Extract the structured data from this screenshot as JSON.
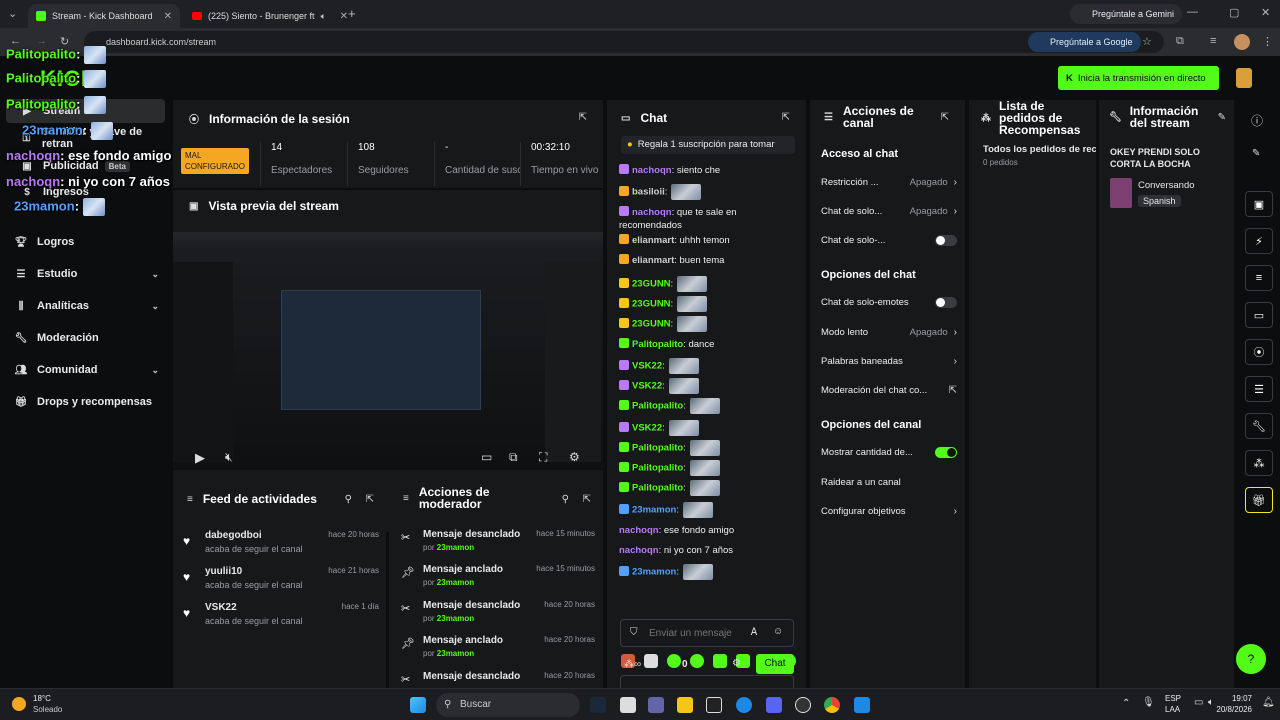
{
  "browser": {
    "tabs": [
      {
        "title": "Stream - Kick Dashboard",
        "active": true
      },
      {
        "title": "(225) Siento - Brunenger ft",
        "active": false
      }
    ],
    "url": "dashboard.kick.com/stream",
    "gemini_label": "Pregúntale a Gemini",
    "google_label": "Pregúntale a Google"
  },
  "header": {
    "start_stream_label": "Inicia la transmisión en directo"
  },
  "overlay_chat": [
    {
      "user": "Palitopalito",
      "text": ":",
      "color": "#53fc18"
    },
    {
      "user": "Palitopalito",
      "text": ":",
      "color": "#53fc18"
    },
    {
      "user": "Palitopalito",
      "text": ":",
      "color": "#53fc18"
    },
    {
      "user": "23mamon",
      "text": ":",
      "color": "#53a0fc"
    },
    {
      "user": "nachoqn",
      "text": ": ese fondo amigo",
      "color": "#b879f7"
    },
    {
      "user": "nachoqn",
      "text": ": ni yo con 7 años",
      "color": "#b879f7"
    },
    {
      "user": "23mamon",
      "text": ":",
      "color": "#53a0fc"
    }
  ],
  "sidebar": {
    "items": [
      {
        "label": "Stream",
        "icon": "stream-icon"
      },
      {
        "label": "Servidor y clave de retran",
        "icon": "key-icon"
      },
      {
        "label": "Publicidad",
        "badge": "Beta",
        "icon": "ad-icon"
      },
      {
        "label": "Ingresos",
        "icon": "money-icon"
      },
      {
        "label": "Logros",
        "icon": "trophy-icon"
      },
      {
        "label": "Estudio",
        "icon": "studio-icon",
        "expandable": true
      },
      {
        "label": "Analíticas",
        "icon": "chart-icon",
        "expandable": true
      },
      {
        "label": "Moderación",
        "icon": "wrench-icon"
      },
      {
        "label": "Comunidad",
        "icon": "users-icon",
        "expandable": true
      },
      {
        "label": "Drops y recompensas",
        "icon": "gift-icon"
      }
    ]
  },
  "session": {
    "title": "Información de la sesión",
    "status_label": "MAL CONFIGURADO",
    "stats": [
      {
        "value": "14",
        "label": "Espectadores"
      },
      {
        "value": "108",
        "label": "Seguidores"
      },
      {
        "value": "-",
        "label": "Cantidad de suscripciones"
      },
      {
        "value": "00:32:10",
        "label": "Tiempo en vivo"
      }
    ]
  },
  "preview": {
    "title": "Vista previa del stream"
  },
  "activity": {
    "title": "Feed de actividades",
    "items": [
      {
        "name": "dabegodboi",
        "sub": "acaba de seguir el canal",
        "time": "hace 20 horas"
      },
      {
        "name": "yuulii10",
        "sub": "acaba de seguir el canal",
        "time": "hace 21 horas"
      },
      {
        "name": "VSK22",
        "sub": "acaba de seguir el canal",
        "time": "hace 1 día"
      }
    ]
  },
  "mod_actions": {
    "title": "Acciones de moderador",
    "items": [
      {
        "name": "Mensaje desanclado",
        "by": "por",
        "user": "23mamon",
        "time": "hace 15 minutos"
      },
      {
        "name": "Mensaje anclado",
        "by": "por",
        "user": "23mamon",
        "time": "hace 15 minutos"
      },
      {
        "name": "Mensaje desanclado",
        "by": "por",
        "user": "23mamon",
        "time": "hace 20 horas"
      },
      {
        "name": "Mensaje anclado",
        "by": "por",
        "user": "23mamon",
        "time": "hace 20 horas"
      },
      {
        "name": "Mensaje desanclado",
        "by": "por",
        "user": "23mamon",
        "time": "hace 20 horas"
      }
    ]
  },
  "chat": {
    "title": "Chat",
    "pinned": "Regala 1 suscripción para tomar",
    "messages": [
      {
        "user": "nachoqn",
        "text": ": siento che",
        "color": "#b879f7"
      },
      {
        "user": "basiloii",
        "text": ":",
        "color": "#cfcfcf"
      },
      {
        "user": "nachoqn",
        "text": ": que te sale en recomendados",
        "color": "#b879f7"
      },
      {
        "user": "elianmart",
        "text": ": uhhh temon",
        "color": "#cfcfcf"
      },
      {
        "user": "elianmart",
        "text": ": buen tema",
        "color": "#cfcfcf"
      },
      {
        "user": "23GUNN",
        "text": ":",
        "color": "#53fc18"
      },
      {
        "user": "23GUNN",
        "text": ":",
        "color": "#53fc18"
      },
      {
        "user": "23GUNN",
        "text": ":",
        "color": "#53fc18"
      },
      {
        "user": "Palitopalito",
        "text": ": dance",
        "color": "#53fc18"
      },
      {
        "user": "VSK22",
        "text": ":",
        "color": "#53fc18"
      },
      {
        "user": "VSK22",
        "text": ":",
        "color": "#53fc18"
      },
      {
        "user": "Palitopalito",
        "text": ":",
        "color": "#53fc18"
      },
      {
        "user": "VSK22",
        "text": ":",
        "color": "#53fc18"
      },
      {
        "user": "Palitopalito",
        "text": ":",
        "color": "#53fc18"
      },
      {
        "user": "Palitopalito",
        "text": ":",
        "color": "#53fc18"
      },
      {
        "user": "Palitopalito",
        "text": ":",
        "color": "#53fc18"
      },
      {
        "user": "23mamon",
        "text": ":",
        "color": "#53a0fc"
      },
      {
        "user": "nachoqn",
        "text": ": ese fondo amigo",
        "color": "#b879f7"
      },
      {
        "user": "nachoqn",
        "text": ": ni yo con 7 años",
        "color": "#b879f7"
      },
      {
        "user": "23mamon",
        "text": ":",
        "color": "#53a0fc"
      }
    ],
    "input_placeholder": "Enviar un mensaje",
    "points": "0",
    "send_label": "Chat"
  },
  "channel_actions": {
    "title": "Acciones de canal",
    "sections": [
      {
        "heading": "Acceso al chat"
      },
      {
        "heading": "Opciones del chat"
      },
      {
        "heading": "Opciones del canal"
      }
    ],
    "rows": [
      {
        "label": "Restricción ...",
        "value": "Apagado",
        "kind": "arrow"
      },
      {
        "label": "Chat de solo...",
        "value": "Apagado",
        "kind": "arrow"
      },
      {
        "label": "Chat de solo-...",
        "value": "",
        "kind": "toggle-off"
      },
      {
        "label": "Chat de solo-emotes",
        "value": "",
        "kind": "toggle-off"
      },
      {
        "label": "Modo lento",
        "value": "Apagado",
        "kind": "arrow"
      },
      {
        "label": "Palabras baneadas",
        "value": "",
        "kind": "arrow"
      },
      {
        "label": "Moderación del chat co...",
        "value": "",
        "kind": "external"
      },
      {
        "label": "Mostrar cantidad de...",
        "value": "",
        "kind": "toggle-on"
      },
      {
        "label": "Raidear a un canal",
        "value": "",
        "kind": "none"
      },
      {
        "label": "Configurar objetivos",
        "value": "",
        "kind": "arrow"
      }
    ]
  },
  "rewards": {
    "title": "Lista de pedidos de Recompensas",
    "all_label": "Todos los pedidos de rec",
    "count": "0 pedidos"
  },
  "stream_info": {
    "title": "Información del stream",
    "stream_title": "OKEY PRENDI SOLO CORTA LA BOCHA",
    "category": "Conversando",
    "language": "Spanish"
  },
  "taskbar": {
    "weather_temp": "18°C",
    "weather_text": "Soleado",
    "search_label": "Buscar",
    "lang1": "ESP",
    "lang2": "LAA",
    "time": "19:07",
    "date": "20/8/2026"
  },
  "colors": {
    "accent": "#53fc18",
    "panel": "#16181a",
    "bg": "#0b0d0e",
    "warning": "#f5a623"
  }
}
